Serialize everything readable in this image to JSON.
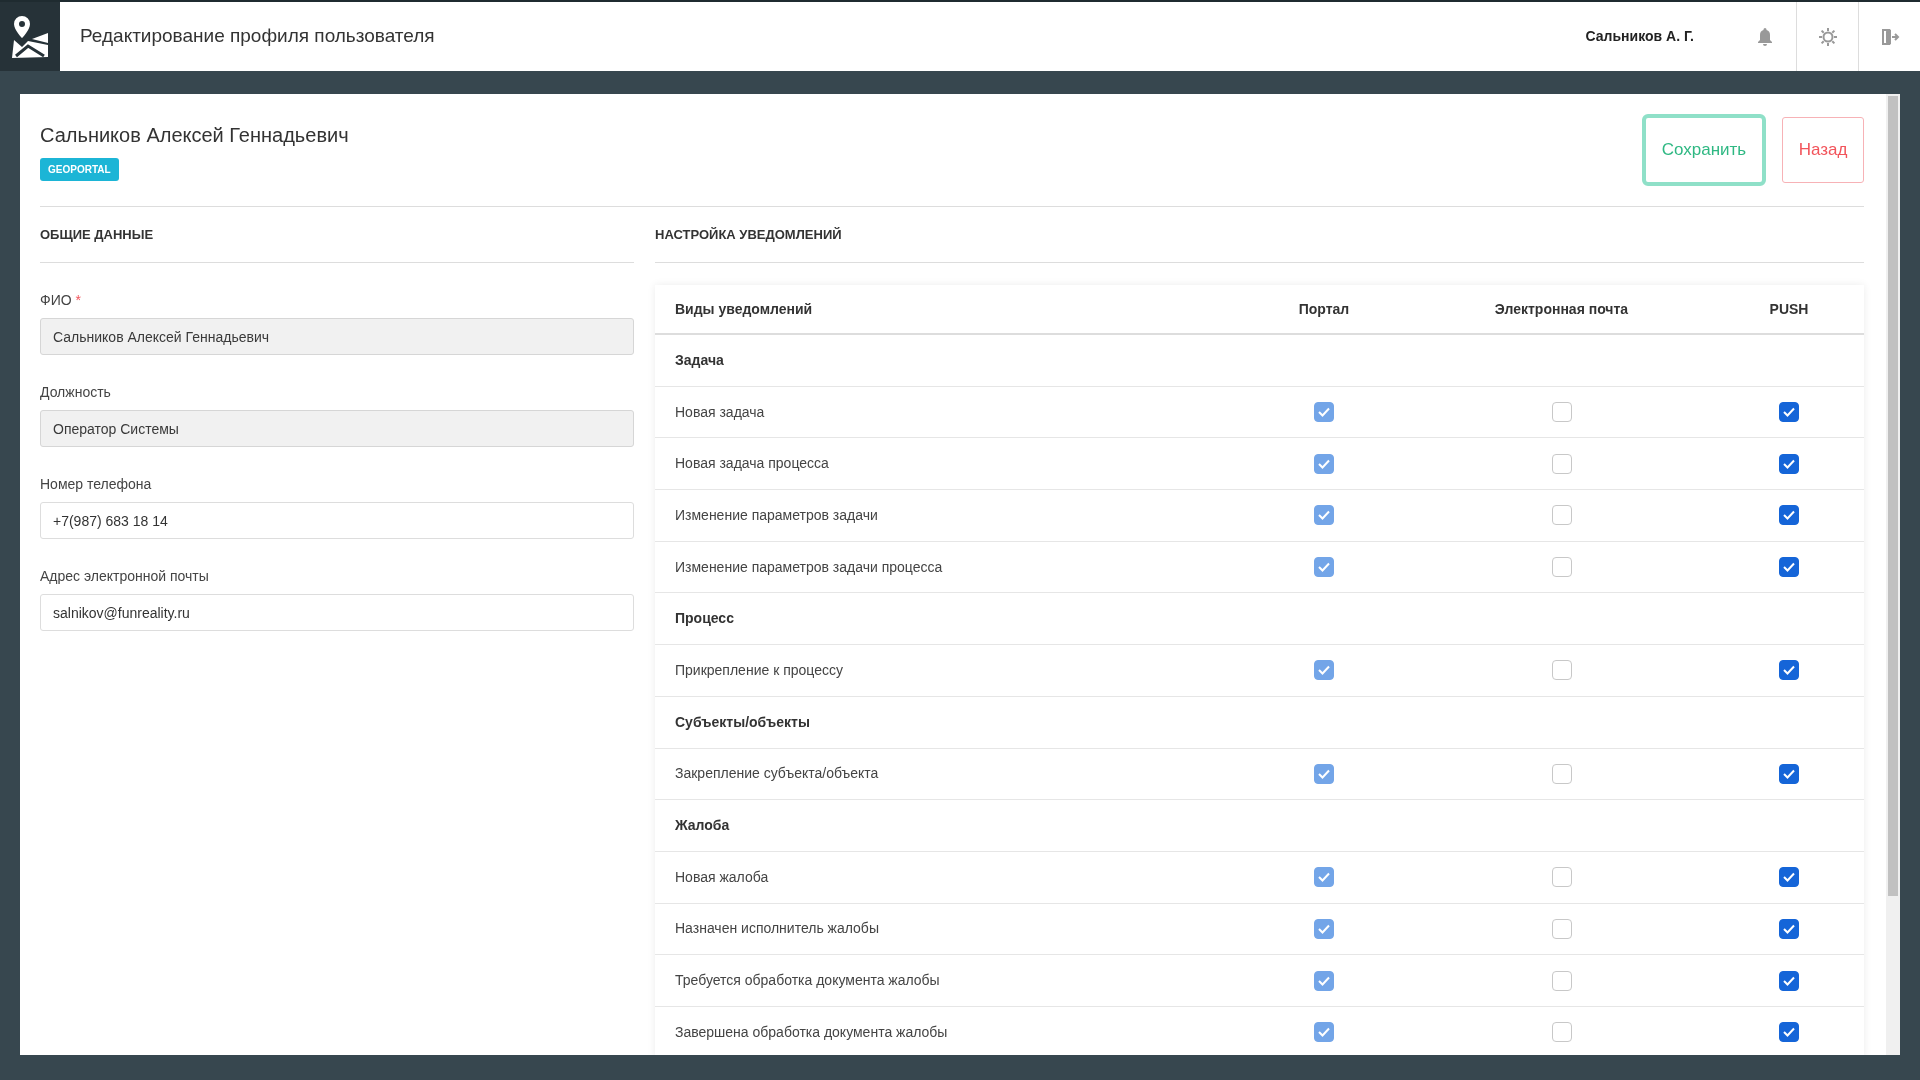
{
  "header": {
    "title": "Редактирование профиля пользователя",
    "user": "Сальников А. Г."
  },
  "profile": {
    "name": "Сальников Алексей Геннадьевич",
    "badge": "GEOPORTAL"
  },
  "actions": [
    {
      "kind": "save",
      "label": "Сохранить"
    },
    {
      "kind": "back",
      "label": "Назад"
    }
  ],
  "general": {
    "title": "ОБЩИЕ ДАННЫЕ",
    "fields": [
      {
        "label": "ФИО",
        "required_mark": "*",
        "value": "Сальников Алексей Геннадьевич",
        "readonly": true
      },
      {
        "label": "Должность",
        "value": "Оператор Системы",
        "readonly": true
      },
      {
        "label": "Номер телефона",
        "value": "+7(987) 683 18 14",
        "readonly": false
      },
      {
        "label": "Адрес электронной почты",
        "value": "salnikov@funreality.ru",
        "readonly": false
      }
    ]
  },
  "notifications": {
    "title": "НАСТРОЙКА УВЕДОМЛЕНИЙ",
    "columns": [
      "Виды уведомлений",
      "Портал",
      "Электронная почта",
      "PUSH"
    ],
    "rows": [
      {
        "kind": "group",
        "label": "Задача"
      },
      {
        "kind": "item",
        "label": "Новая задача",
        "channels": [
          {
            "checked": true,
            "disabled": true
          },
          {
            "checked": false,
            "disabled": false
          },
          {
            "checked": true,
            "disabled": false
          }
        ]
      },
      {
        "kind": "item",
        "label": "Новая задача процесса",
        "channels": [
          {
            "checked": true,
            "disabled": true
          },
          {
            "checked": false,
            "disabled": false
          },
          {
            "checked": true,
            "disabled": false
          }
        ]
      },
      {
        "kind": "item",
        "label": "Изменение параметров задачи",
        "channels": [
          {
            "checked": true,
            "disabled": true
          },
          {
            "checked": false,
            "disabled": false
          },
          {
            "checked": true,
            "disabled": false
          }
        ]
      },
      {
        "kind": "item",
        "label": "Изменение параметров задачи процесса",
        "channels": [
          {
            "checked": true,
            "disabled": true
          },
          {
            "checked": false,
            "disabled": false
          },
          {
            "checked": true,
            "disabled": false
          }
        ]
      },
      {
        "kind": "group",
        "label": "Процесс"
      },
      {
        "kind": "item",
        "label": "Прикрепление к процессу",
        "channels": [
          {
            "checked": true,
            "disabled": true
          },
          {
            "checked": false,
            "disabled": false
          },
          {
            "checked": true,
            "disabled": false
          }
        ]
      },
      {
        "kind": "group",
        "label": "Субъекты/объекты"
      },
      {
        "kind": "item",
        "label": "Закрепление субъекта/объекта",
        "channels": [
          {
            "checked": true,
            "disabled": true
          },
          {
            "checked": false,
            "disabled": false
          },
          {
            "checked": true,
            "disabled": false
          }
        ]
      },
      {
        "kind": "group",
        "label": "Жалоба"
      },
      {
        "kind": "item",
        "label": "Новая жалоба",
        "channels": [
          {
            "checked": true,
            "disabled": true
          },
          {
            "checked": false,
            "disabled": false
          },
          {
            "checked": true,
            "disabled": false
          }
        ]
      },
      {
        "kind": "item",
        "label": "Назначен исполнитель жалобы",
        "channels": [
          {
            "checked": true,
            "disabled": true
          },
          {
            "checked": false,
            "disabled": false
          },
          {
            "checked": true,
            "disabled": false
          }
        ]
      },
      {
        "kind": "item",
        "label": "Требуется обработка документа жалобы",
        "channels": [
          {
            "checked": true,
            "disabled": true
          },
          {
            "checked": false,
            "disabled": false
          },
          {
            "checked": true,
            "disabled": false
          }
        ]
      },
      {
        "kind": "item",
        "label": "Завершена обработка документа жалобы",
        "channels": [
          {
            "checked": true,
            "disabled": true
          },
          {
            "checked": false,
            "disabled": false
          },
          {
            "checked": true,
            "disabled": false
          }
        ]
      }
    ]
  }
}
